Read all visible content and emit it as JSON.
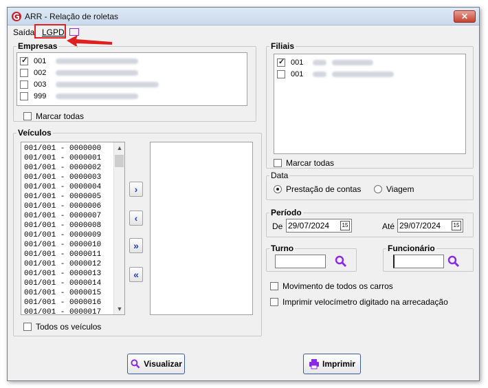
{
  "window": {
    "title": "ARR -  Relação de roletas",
    "close_label": "✕"
  },
  "menu": {
    "saida": "Saída",
    "lgpd": "LGPD"
  },
  "empresas": {
    "legend": "Empresas",
    "items": [
      {
        "code": "001",
        "checked": true
      },
      {
        "code": "002",
        "checked": false
      },
      {
        "code": "003",
        "checked": false
      },
      {
        "code": "999",
        "checked": false
      }
    ],
    "marcar_todas": "Marcar todas"
  },
  "filiais": {
    "legend": "Filiais",
    "items": [
      {
        "code": "001",
        "checked": true
      },
      {
        "code": "001",
        "checked": false
      }
    ],
    "marcar_todas": "Marcar todas"
  },
  "veiculos": {
    "legend": "Veículos",
    "items": [
      "001/001 - 0000000",
      "001/001 - 0000001",
      "001/001 - 0000002",
      "001/001 - 0000003",
      "001/001 - 0000004",
      "001/001 - 0000005",
      "001/001 - 0000006",
      "001/001 - 0000007",
      "001/001 - 0000008",
      "001/001 - 0000009",
      "001/001 - 0000010",
      "001/001 - 0000011",
      "001/001 - 0000012",
      "001/001 - 0000013",
      "001/001 - 0000014",
      "001/001 - 0000015",
      "001/001 - 0000016",
      "001/001 - 0000017"
    ],
    "todos": "Todos os veículos",
    "buttons": {
      "add": "›",
      "remove": "‹",
      "add_all": "»",
      "remove_all": "«"
    }
  },
  "data": {
    "legend": "Data",
    "options": [
      {
        "label": "Prestação de contas",
        "checked": true
      },
      {
        "label": "Viagem",
        "checked": false
      }
    ]
  },
  "periodo": {
    "legend": "Período",
    "de_label": "De",
    "de_value": "29/07/2024",
    "ate_label": "Até",
    "ate_value": "29/07/2024",
    "cal": "15"
  },
  "turno": {
    "legend": "Turno",
    "value": ""
  },
  "funcionario": {
    "legend": "Funcionário",
    "value": ""
  },
  "options": {
    "movimento": "Movimento de todos os carros",
    "velocimetro": "Imprimir velocímetro digitado na arrecadação"
  },
  "buttons": {
    "visualizar": "Visualizar",
    "imprimir": "Imprimir"
  },
  "colors": {
    "accent": "#8a2be2",
    "highlight": "#e02020",
    "arrow_blue": "#1f3fbf"
  }
}
